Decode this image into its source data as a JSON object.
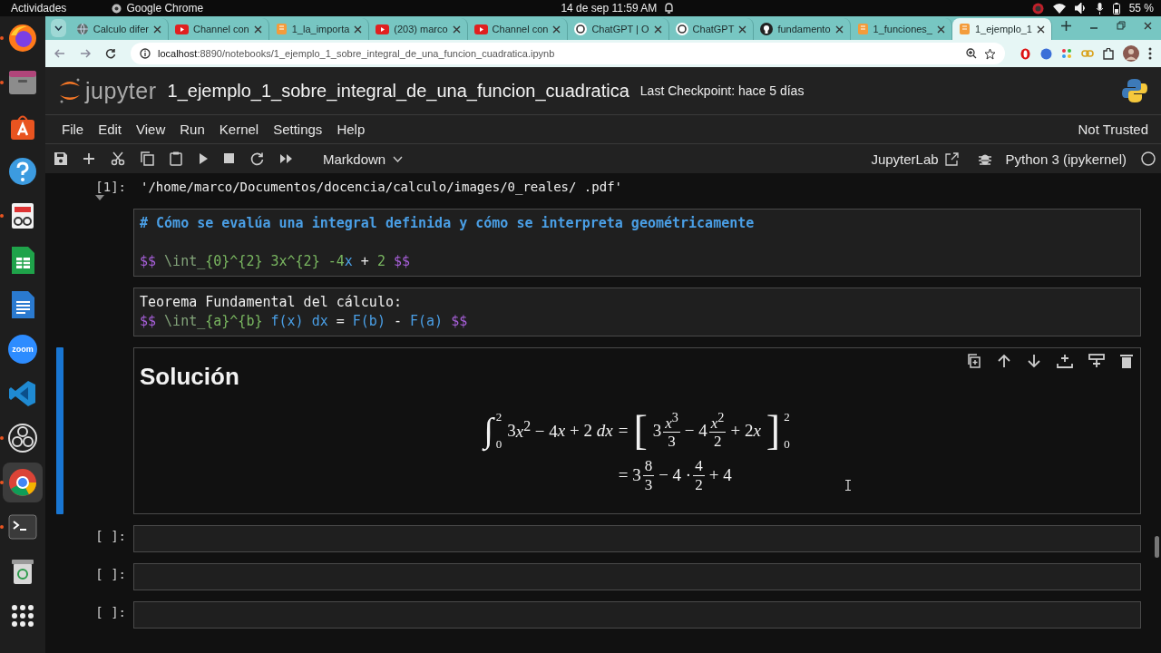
{
  "top_bar": {
    "activities": "Actividades",
    "app": "Google Chrome",
    "clock": "14 de sep  11:59 AM",
    "battery": "55 %"
  },
  "dock": [
    {
      "kind": "firefox",
      "running": true,
      "selected": false
    },
    {
      "kind": "files",
      "running": true,
      "selected": false
    },
    {
      "kind": "appcenter",
      "running": false,
      "selected": false
    },
    {
      "kind": "help",
      "running": false,
      "selected": false
    },
    {
      "kind": "docviewer",
      "running": true,
      "selected": false
    },
    {
      "kind": "spreadsheet",
      "running": false,
      "selected": false
    },
    {
      "kind": "writer",
      "running": false,
      "selected": false
    },
    {
      "kind": "zoom",
      "label": "zoom",
      "running": false,
      "selected": false
    },
    {
      "kind": "vscode",
      "running": false,
      "selected": false
    },
    {
      "kind": "obs",
      "running": true,
      "selected": false
    },
    {
      "kind": "chrome",
      "running": true,
      "selected": true
    },
    {
      "kind": "terminal",
      "running": true,
      "selected": false
    },
    {
      "kind": "trash",
      "running": false,
      "selected": false
    },
    {
      "kind": "apps",
      "running": false,
      "selected": false
    }
  ],
  "browser": {
    "tabs": [
      {
        "title": "Calculo difer",
        "kind": "globe",
        "selected": false
      },
      {
        "title": "Channel con",
        "kind": "youtube",
        "selected": false
      },
      {
        "title": "1_la_importa",
        "kind": "jupyter",
        "selected": false
      },
      {
        "title": "(203) marco",
        "kind": "youtube",
        "selected": false
      },
      {
        "title": "Channel con",
        "kind": "youtube",
        "selected": false
      },
      {
        "title": "ChatGPT | O",
        "kind": "chatgpt",
        "selected": false
      },
      {
        "title": "ChatGPT",
        "kind": "chatgpt",
        "selected": false
      },
      {
        "title": "fundamento",
        "kind": "github",
        "selected": false
      },
      {
        "title": "1_funciones_",
        "kind": "jupyter",
        "selected": false
      },
      {
        "title": "1_ejemplo_1",
        "kind": "jupyter",
        "selected": true
      }
    ],
    "url_host": "localhost",
    "url_rest": ":8890/notebooks/1_ejemplo_1_sobre_integral_de_una_funcion_cuadratica.ipynb"
  },
  "notebook": {
    "logo_text": "jupyter",
    "title": "1_ejemplo_1_sobre_integral_de_una_funcion_cuadratica",
    "checkpoint": "Last Checkpoint: hace 5 días",
    "menu": [
      "File",
      "Edit",
      "View",
      "Run",
      "Kernel",
      "Settings",
      "Help"
    ],
    "trust": "Not Trusted",
    "cell_type": "Markdown",
    "jupyterlab": "JupyterLab",
    "kernel": "Python 3 (ipykernel)",
    "cells": [
      {
        "kind": "output",
        "prompt": "[1]:",
        "text": "'/home/marco/Documentos/docencia/calculo/images/0_reales/ .pdf'",
        "selected": false
      },
      {
        "kind": "source",
        "selected": false,
        "lines": [
          {
            "kind": "code",
            "tokens": [
              {
                "kind": "heading",
                "text": "# Cómo se evalúa una integral definida y cómo se interpreta geométricamente"
              }
            ]
          },
          {
            "kind": "blank"
          },
          {
            "kind": "code",
            "tokens": [
              {
                "kind": "delim",
                "text": "$$"
              },
              {
                "kind": "command",
                "text": " \\int_"
              },
              {
                "kind": "arg",
                "text": "{0}^{2} 3x^{2} "
              },
              {
                "kind": "arg",
                "text": "-4"
              },
              {
                "kind": "var",
                "text": "x"
              },
              {
                "kind": "plain",
                "text": " + "
              },
              {
                "kind": "arg",
                "text": "2 "
              },
              {
                "kind": "delim",
                "text": "$$"
              }
            ]
          }
        ]
      },
      {
        "kind": "source",
        "selected": false,
        "lines": [
          {
            "kind": "code",
            "tokens": [
              {
                "kind": "plain",
                "text": "Teorema Fundamental del cálculo:"
              }
            ]
          },
          {
            "kind": "code",
            "tokens": [
              {
                "kind": "delim",
                "text": "$$"
              },
              {
                "kind": "command",
                "text": " \\int_"
              },
              {
                "kind": "arg",
                "text": "{a}^{b} "
              },
              {
                "kind": "var",
                "text": "f(x) dx"
              },
              {
                "kind": "plain",
                "text": " = "
              },
              {
                "kind": "var",
                "text": "F(b)"
              },
              {
                "kind": "plain",
                "text": " - "
              },
              {
                "kind": "var",
                "text": "F(a) "
              },
              {
                "kind": "delim",
                "text": "$$"
              }
            ]
          }
        ]
      },
      {
        "kind": "rendered",
        "selected": true,
        "heading": "Solución",
        "math": [
          {
            "lhs": [
              {
                "kind": "integral",
                "symbol": "∫",
                "upper": "2",
                "lower": "0"
              },
              {
                "kind": "text",
                "text": "3"
              },
              {
                "kind": "text",
                "text": "*x*$^{2}$ − 4"
              },
              {
                "kind": "text",
                "text": "*x* + 2 *dx*"
              }
            ],
            "rhs": [
              {
                "kind": "text",
                "text": "="
              },
              {
                "kind": "bracket",
                "symbol": "["
              },
              {
                "kind": "text",
                "text": "3"
              },
              {
                "kind": "frac",
                "num": "*x*$^{3}$",
                "den": "3"
              },
              {
                "kind": "text",
                "text": "− 4"
              },
              {
                "kind": "frac",
                "num": "*x*$^{2}$",
                "den": "2"
              },
              {
                "kind": "text",
                "text": "+ 2"
              },
              {
                "kind": "text",
                "text": "*x*"
              },
              {
                "kind": "bracket",
                "symbol": "]",
                "upper": "2",
                "lower": "0"
              }
            ]
          },
          {
            "rhs": [
              {
                "kind": "text",
                "text": "= 3"
              },
              {
                "kind": "frac",
                "num": "8",
                "den": "3"
              },
              {
                "kind": "text",
                "text": "− 4 ·"
              },
              {
                "kind": "frac",
                "num": "4",
                "den": "2"
              },
              {
                "kind": "text",
                "text": "+ 4"
              }
            ]
          }
        ]
      },
      {
        "kind": "empty",
        "prompt": "[ ]:",
        "selected": false
      },
      {
        "kind": "empty",
        "prompt": "[ ]:",
        "selected": false
      },
      {
        "kind": "empty",
        "prompt": "[ ]:",
        "selected": false
      }
    ]
  }
}
